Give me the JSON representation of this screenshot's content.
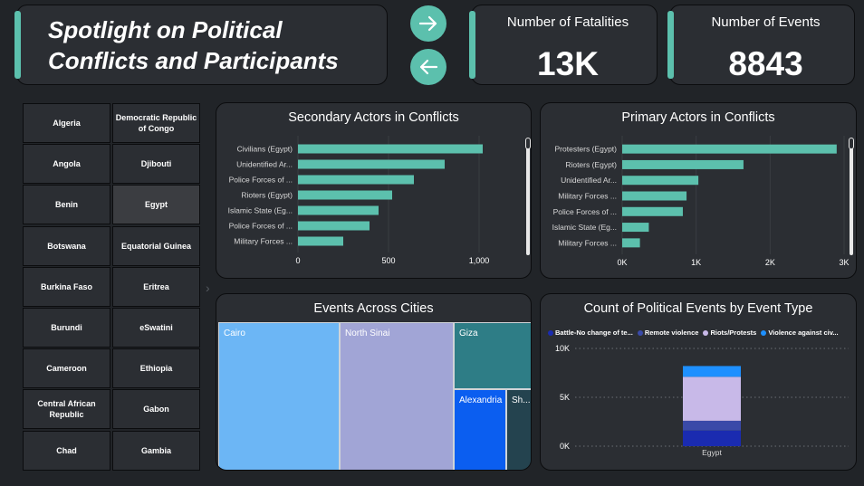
{
  "header": {
    "title": "Spotlight on Political Conflicts and Participants",
    "next_icon": "arrow-right-icon",
    "prev_icon": "arrow-left-icon",
    "accent_color": "#5cc0ad"
  },
  "kpis": {
    "fatalities": {
      "label": "Number of Fatalities",
      "value": "13K"
    },
    "events": {
      "label": "Number of Events",
      "value": "8843"
    }
  },
  "slicer": {
    "selected": "Egypt",
    "items": [
      "Algeria",
      "Democratic Republic of Congo",
      "Angola",
      "Djibouti",
      "Benin",
      "Egypt",
      "Botswana",
      "Equatorial Guinea",
      "Burkina Faso",
      "Eritrea",
      "Burundi",
      "eSwatini",
      "Cameroon",
      "Ethiopia",
      "Central African Republic",
      "Gabon",
      "Chad",
      "Gambia"
    ]
  },
  "chart_data": [
    {
      "type": "bar",
      "orientation": "horizontal",
      "title": "Secondary Actors in Conflicts",
      "categories": [
        "Civilians (Egypt)",
        "Unidentified Ar...",
        "Police Forces of ...",
        "Rioters (Egypt)",
        "Islamic State (Eg...",
        "Police Forces of ...",
        "Military Forces ..."
      ],
      "values": [
        1020,
        810,
        640,
        520,
        445,
        395,
        250
      ],
      "xlim": [
        0,
        1200
      ],
      "xticks": [
        0,
        500,
        1000
      ],
      "xtick_labels": [
        "0",
        "500",
        "1,000"
      ],
      "color": "#5cc0ad"
    },
    {
      "type": "bar",
      "orientation": "horizontal",
      "title": "Primary Actors in Conflicts",
      "categories": [
        "Protesters (Egypt)",
        "Rioters (Egypt)",
        "Unidentified Ar...",
        "Military Forces ...",
        "Police Forces of ...",
        "Islamic State (Eg...",
        "Military Forces ..."
      ],
      "values": [
        2900,
        1640,
        1030,
        870,
        820,
        360,
        240
      ],
      "xlim": [
        0,
        3000
      ],
      "xticks": [
        0,
        1000,
        2000,
        3000
      ],
      "xtick_labels": [
        "0K",
        "1K",
        "2K",
        "3K"
      ],
      "color": "#5cc0ad"
    },
    {
      "type": "treemap",
      "title": "Events Across Cities",
      "items": [
        {
          "label": "Cairo",
          "color": "#6cb6f5"
        },
        {
          "label": "North Sinai",
          "color": "#a1a5d6"
        },
        {
          "label": "Giza",
          "color": "#2e7d86"
        },
        {
          "label": "Alexandria",
          "color": "#0b5ef0"
        },
        {
          "label": "Sh...",
          "color": "#24434f"
        }
      ]
    },
    {
      "type": "bar",
      "stacked": true,
      "title": "Count of Political Events by Event Type",
      "categories": [
        "Egypt"
      ],
      "ylim": [
        0,
        10000
      ],
      "yticks": [
        0,
        5000,
        10000
      ],
      "ytick_labels": [
        "0K",
        "5K",
        "10K"
      ],
      "legend_position": "top",
      "series": [
        {
          "name": "Battle-No change of te...",
          "values": [
            1600
          ],
          "color": "#1a2bb0"
        },
        {
          "name": "Remote violence",
          "values": [
            1000
          ],
          "color": "#3a4aa8"
        },
        {
          "name": "Riots/Protests",
          "values": [
            4500
          ],
          "color": "#c8b9e8"
        },
        {
          "name": "Violence against civ...",
          "values": [
            1100
          ],
          "color": "#1e90ff"
        }
      ]
    }
  ]
}
